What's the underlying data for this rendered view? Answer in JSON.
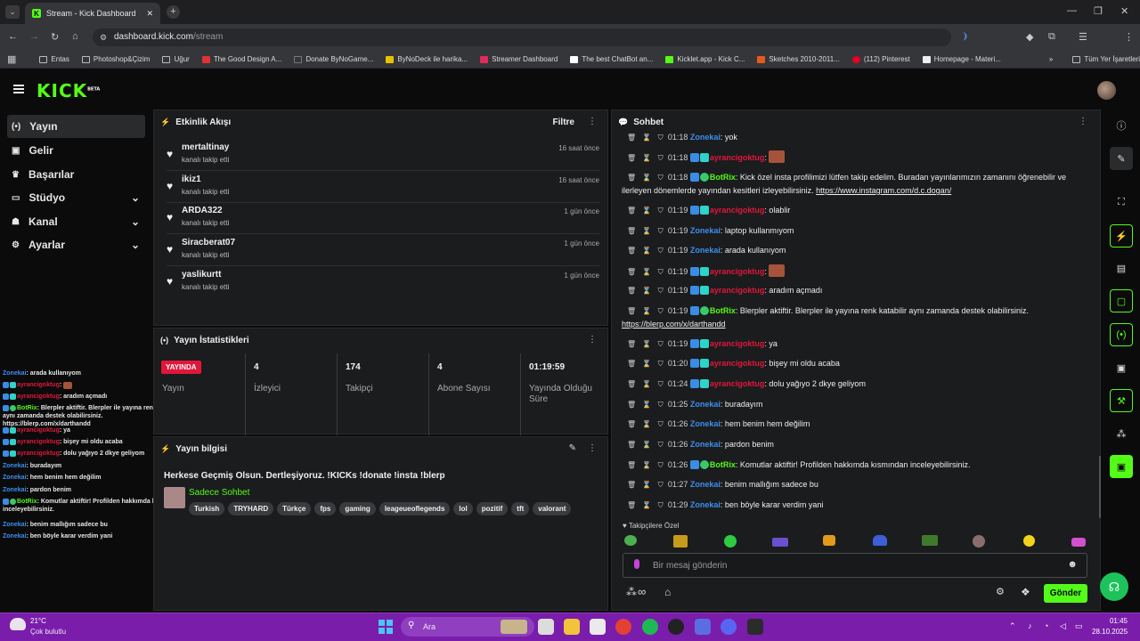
{
  "browser": {
    "tab_title": "Stream - Kick Dashboard",
    "url_host": "dashboard.kick.com",
    "url_path": "/stream",
    "bookmarks": [
      "Entas",
      "Photoshop&Çizim",
      "Uğur",
      "The Good Design A...",
      "Donate ByNoGame...",
      "ByNoDeck ile harika...",
      "Streamer Dashboard",
      "The best ChatBot an...",
      "Kicklet.app - Kick C...",
      "Sketches 2010-2011...",
      "(112) Pinterest",
      "Homepage - Materi..."
    ],
    "bookmarks_more": "»",
    "all_bookmarks": "Tüm Yer İşaretleri"
  },
  "app": {
    "logo": "KICK",
    "logo_beta": "BETA"
  },
  "sidebar": {
    "items": [
      {
        "label": "Yayın",
        "icon": "broadcast-icon"
      },
      {
        "label": "Gelir",
        "icon": "revenue-icon"
      },
      {
        "label": "Başarılar",
        "icon": "trophy-icon"
      },
      {
        "label": "Stüdyo",
        "icon": "studio-icon"
      },
      {
        "label": "Kanal",
        "icon": "channel-icon"
      },
      {
        "label": "Ayarlar",
        "icon": "gear-icon"
      }
    ]
  },
  "activity": {
    "title": "Etkinlik Akışı",
    "filter": "Filtre",
    "events": [
      {
        "name": "mertaltinay",
        "action": "kanalı takip etti",
        "time": "16 saat önce"
      },
      {
        "name": "ikiz1",
        "action": "kanalı takip etti",
        "time": "16 saat önce"
      },
      {
        "name": "ARDA322",
        "action": "kanalı takip etti",
        "time": "1 gün önce"
      },
      {
        "name": "Siracberat07",
        "action": "kanalı takip etti",
        "time": "1 gün önce"
      },
      {
        "name": "yaslikurtt",
        "action": "kanalı takip etti",
        "time": "1 gün önce"
      }
    ]
  },
  "stats": {
    "title": "Yayın İstatistikleri",
    "live_badge": "YAYINDA",
    "items": [
      {
        "value": "",
        "label": "Yayın"
      },
      {
        "value": "4",
        "label": "İzleyici"
      },
      {
        "value": "174",
        "label": "Takipçi"
      },
      {
        "value": "4",
        "label": "Abone Sayısı"
      },
      {
        "value": "01:19:59",
        "label": "Yayında Olduğu Süre"
      }
    ]
  },
  "info": {
    "title": "Yayın bilgisi",
    "stream_title": "Herkese Geçmiş Olsun. Dertleşiyoruz. !KICKs !donate !insta !blerp",
    "category": "Sadece Sohbet",
    "tags": [
      "Turkish",
      "TRYHARD",
      "Türkçe",
      "fps",
      "gaming",
      "leageueoflegends",
      "lol",
      "pozitif",
      "tft",
      "valorant"
    ]
  },
  "chat": {
    "title": "Sohbet",
    "messages": [
      {
        "time": "01:18",
        "user": "Zonekai",
        "type": "zone",
        "text": ": yok"
      },
      {
        "time": "01:18",
        "user": "ayrancigoktug",
        "type": "ayr",
        "text": ":",
        "emote": true
      },
      {
        "time": "01:18",
        "user": "BotRix",
        "type": "bot",
        "text": ": Kick özel insta profilimizi lütfen takip edelim. Buradan yayınlarımızın zamanını öğrenebilir ve ilerleyen dönemlerde yayından kesitleri izleyebilirsiniz.",
        "link": "https://www.instagram.com/d.c.dogan/"
      },
      {
        "time": "01:19",
        "user": "ayrancigoktug",
        "type": "ayr",
        "text": ": olablir"
      },
      {
        "time": "01:19",
        "user": "Zonekai",
        "type": "zone",
        "text": ": laptop kullanmıyom"
      },
      {
        "time": "01:19",
        "user": "Zonekai",
        "type": "zone",
        "text": ": arada kullanıyom"
      },
      {
        "time": "01:19",
        "user": "ayrancigoktug",
        "type": "ayr",
        "text": ":",
        "emote": true
      },
      {
        "time": "01:19",
        "user": "ayrancigoktug",
        "type": "ayr",
        "text": ": aradım açmadı"
      },
      {
        "time": "01:19",
        "user": "BotRix",
        "type": "bot",
        "text": ": Blerpler aktiftir. Blerpler ile yayına renk katabilir aynı zamanda destek olabilirsiniz.",
        "link": "https://blerp.com/x/darthandd"
      },
      {
        "time": "01:19",
        "user": "ayrancigoktug",
        "type": "ayr",
        "text": ": ya"
      },
      {
        "time": "01:20",
        "user": "ayrancigoktug",
        "type": "ayr",
        "text": ": bişey mi oldu acaba"
      },
      {
        "time": "01:24",
        "user": "ayrancigoktug",
        "type": "ayr",
        "text": ": dolu yağıyo 2 dkye geliyom"
      },
      {
        "time": "01:25",
        "user": "Zonekai",
        "type": "zone",
        "text": ": buradayım"
      },
      {
        "time": "01:26",
        "user": "Zonekai",
        "type": "zone",
        "text": ": hem benim hem değilim"
      },
      {
        "time": "01:26",
        "user": "Zonekai",
        "type": "zone",
        "text": ": pardon benim"
      },
      {
        "time": "01:26",
        "user": "BotRix",
        "type": "bot",
        "text": ": Komutlar aktiftir! Profilden hakkımda kısmından inceleyebilirsiniz."
      },
      {
        "time": "01:27",
        "user": "Zonekai",
        "type": "zone",
        "text": ": benim mallığım sadece bu"
      },
      {
        "time": "01:29",
        "user": "Zonekai",
        "type": "zone",
        "text": ": ben böyle karar verdim yani"
      }
    ],
    "followers_special": "Takipçilere Özel",
    "input_placeholder": "Bir mesaj gönderin",
    "send": "Gönder"
  },
  "overlay": {
    "lines": [
      {
        "user": "Zonekai",
        "type": "zone",
        "text": ": arada kullanıyom"
      },
      {
        "user": "ayrancigoktug",
        "type": "ayr",
        "text": ":",
        "emote": true
      },
      {
        "user": "ayrancigoktug",
        "type": "ayr",
        "text": ": aradım açmadı"
      },
      {
        "user": "BotRix",
        "type": "bot",
        "text": ": Blerpler aktiftir. Blerpler ile yayına renk katabilir aynı zamanda destek olabilirsiniz. https://blerp.com/x/darthandd"
      },
      {
        "user": "ayrancigoktug",
        "type": "ayr",
        "text": ": ya"
      },
      {
        "user": "ayrancigoktug",
        "type": "ayr",
        "text": ": bişey mi oldu acaba"
      },
      {
        "user": "ayrancigoktug",
        "type": "ayr",
        "text": ": dolu yağıyo 2 dkye geliyom"
      },
      {
        "user": "Zonekai",
        "type": "zone",
        "text": ": buradayım"
      },
      {
        "user": "Zonekai",
        "type": "zone",
        "text": ": hem benim hem değilim"
      },
      {
        "user": "Zonekai",
        "type": "zone",
        "text": ": pardon benim"
      },
      {
        "user": "BotRix",
        "type": "bot",
        "text": ": Komutlar aktiftir! Profilden hakkımda kısmından inceleyebilirsiniz."
      },
      {
        "user": "Zonekai",
        "type": "zone",
        "text": ": benim mallığım sadece bu"
      },
      {
        "user": "Zonekai",
        "type": "zone",
        "text": ": ben böyle karar verdim yani"
      }
    ]
  },
  "taskbar": {
    "weather_temp": "21°C",
    "weather_desc": "Çok bulutlu",
    "search": "Ara",
    "time": "01:45",
    "date": "28.10.2025"
  },
  "colors": {
    "accent": "#53fc18",
    "live": "#e0173a",
    "zonekai": "#3d8ef0",
    "ayrancigoktug": "#e0173a",
    "taskbar": "#7a1dab"
  }
}
